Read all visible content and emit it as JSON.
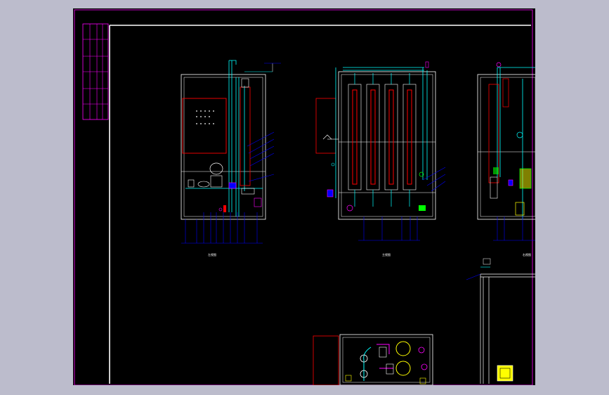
{
  "viewer": {
    "background_color": "#bcbccc",
    "canvas_color": "#000000"
  },
  "drawing": {
    "colors": {
      "frame": "#ff00ff",
      "border": "#ffffff",
      "equipment": "#ffffff",
      "pipe": "#00ffff",
      "panel": "#ff0000",
      "tube": "#ff0000",
      "valve": "#00ff00",
      "pump": "#ffff00",
      "leader": "#0000ff",
      "accent": "#ff00ff"
    },
    "views": [
      {
        "id": "left-elevation",
        "caption": "左视图"
      },
      {
        "id": "front-elevation",
        "caption": "主视图"
      },
      {
        "id": "right-elevation",
        "caption": "右视图"
      }
    ],
    "sub_views": [
      {
        "id": "plan-view"
      },
      {
        "id": "pipe-detail"
      }
    ],
    "icons": {
      "motor": "motor-icon",
      "pump": "pump-icon",
      "valve": "valve-icon",
      "gauge": "gauge-icon"
    }
  }
}
